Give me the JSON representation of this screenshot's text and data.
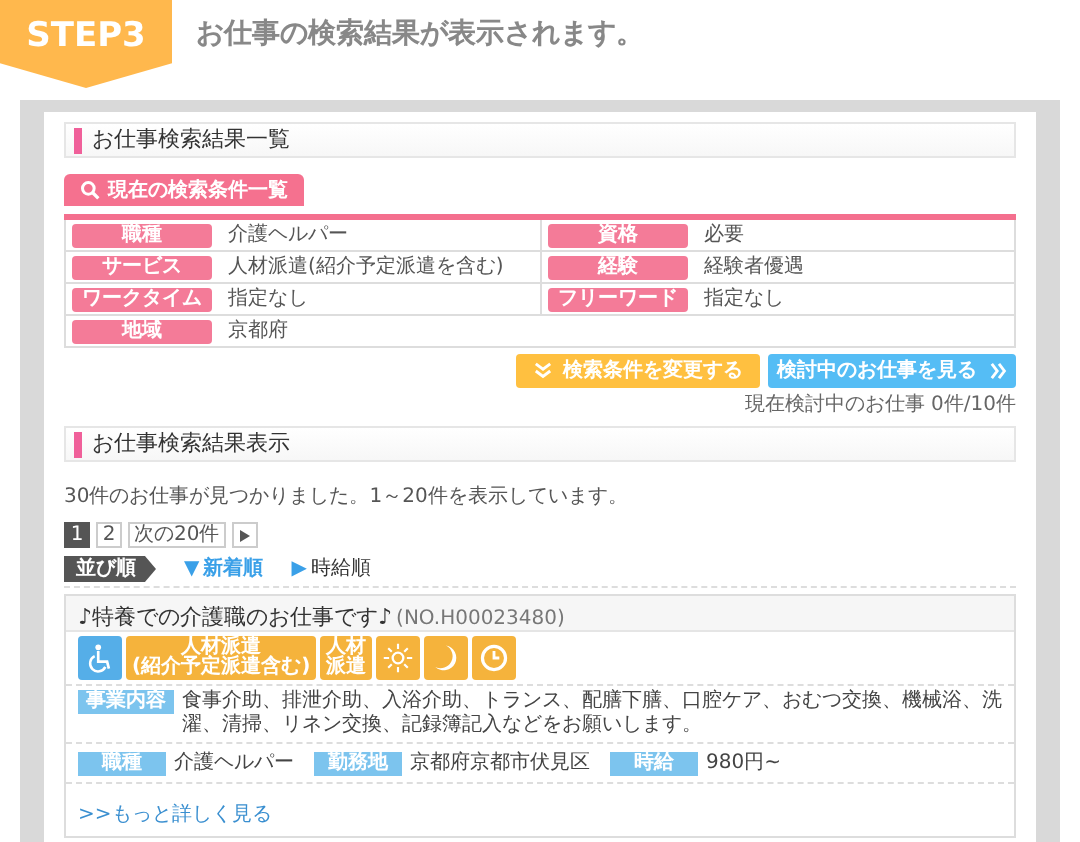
{
  "step": {
    "badge": "STEP3",
    "caption": "お仕事の検索結果が表示されます。"
  },
  "list_heading": "お仕事検索結果一覧",
  "conditions": {
    "tab": "現在の検索条件一覧",
    "rows": [
      [
        {
          "label": "職種",
          "value": "介護ヘルパー"
        },
        {
          "label": "資格",
          "value": "必要"
        }
      ],
      [
        {
          "label": "サービス",
          "value": "人材派遣(紹介予定派遣を含む)"
        },
        {
          "label": "経験",
          "value": "経験者優遇"
        }
      ],
      [
        {
          "label": "ワークタイム",
          "value": "指定なし"
        },
        {
          "label": "フリーワード",
          "value": "指定なし"
        }
      ],
      [
        {
          "label": "地域",
          "value": "京都府"
        }
      ]
    ]
  },
  "buttons": [
    {
      "kind": "change",
      "label": "検索条件を変更する"
    },
    {
      "kind": "view",
      "label": "検討中のお仕事を見る"
    }
  ],
  "saved_count": "現在検討中のお仕事 0件/10件",
  "results_heading": "お仕事検索結果表示",
  "summary": "30件のお仕事が見つかりました。1～20件を表示しています。",
  "pagination": [
    {
      "label": "1",
      "selected": true
    },
    {
      "label": "2",
      "selected": false
    },
    {
      "label": "次の20件",
      "selected": false
    }
  ],
  "sort": {
    "label": "並び順",
    "options": [
      {
        "marker": "▼",
        "label": "新着順",
        "selected": true
      },
      {
        "marker": "▶",
        "label": "時給順",
        "selected": false
      }
    ]
  },
  "jobs": [
    {
      "title": "♪特養での介護職のお仕事です♪",
      "number": "(NO.H00023480)",
      "badges": [
        {
          "kind": "wheelchair"
        },
        {
          "kind": "tag",
          "lines": [
            "人材派遣",
            "(紹介予定派遣含む)"
          ]
        },
        {
          "kind": "tag",
          "lines": [
            "人材",
            "派遣"
          ]
        },
        {
          "kind": "sun"
        },
        {
          "kind": "moon"
        },
        {
          "kind": "clock"
        }
      ],
      "description_label": "事業内容",
      "description": "食事介助、排泄介助、入浴介助、トランス、配膳下膳、口腔ケア、おむつ交換、機械浴、洗濯、清掃、リネン交換、記録簿記入などをお願いします。",
      "details": [
        {
          "label": "職種",
          "value": "介護ヘルパー"
        },
        {
          "label": "勤務地",
          "value": "京都府京都市伏見区"
        },
        {
          "label": "時給",
          "value": "980円~"
        }
      ],
      "more_link": ">>もっと詳しく見る"
    }
  ]
}
